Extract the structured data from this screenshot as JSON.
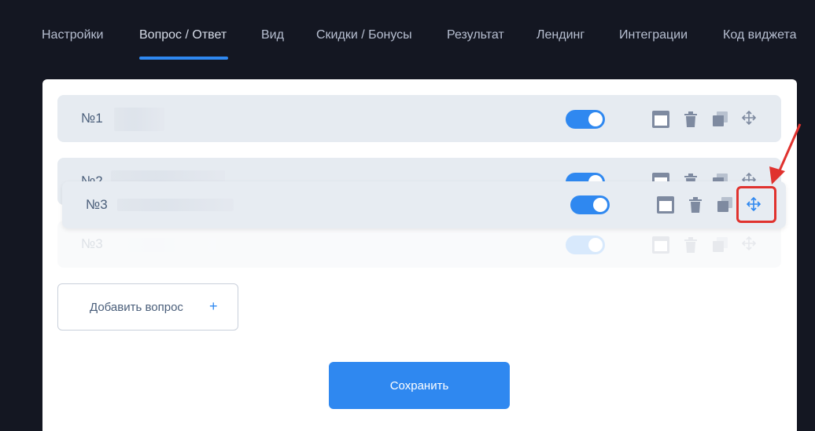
{
  "tabs": [
    {
      "label": "Настройки",
      "active": false
    },
    {
      "label": "Вопрос / Ответ",
      "active": true
    },
    {
      "label": "Вид",
      "active": false
    },
    {
      "label": "Скидки / Бонусы",
      "active": false
    },
    {
      "label": "Результат",
      "active": false
    },
    {
      "label": "Лендинг",
      "active": false
    },
    {
      "label": "Интеграции",
      "active": false
    },
    {
      "label": "Код виджета",
      "active": false
    }
  ],
  "questions": [
    {
      "label": "№1",
      "enabled": true
    },
    {
      "label": "№2",
      "enabled": true
    },
    {
      "label": "№3",
      "enabled": true
    }
  ],
  "dragging": {
    "label": "№3",
    "enabled": true
  },
  "add_question_label": "Добавить вопрос",
  "add_question_icon": "+",
  "save_label": "Сохранить",
  "colors": {
    "accent": "#2f88f0",
    "background": "#141722",
    "highlight": "#e0322e"
  },
  "icons": [
    "window-icon",
    "trash-icon",
    "copy-icon",
    "move-icon"
  ]
}
